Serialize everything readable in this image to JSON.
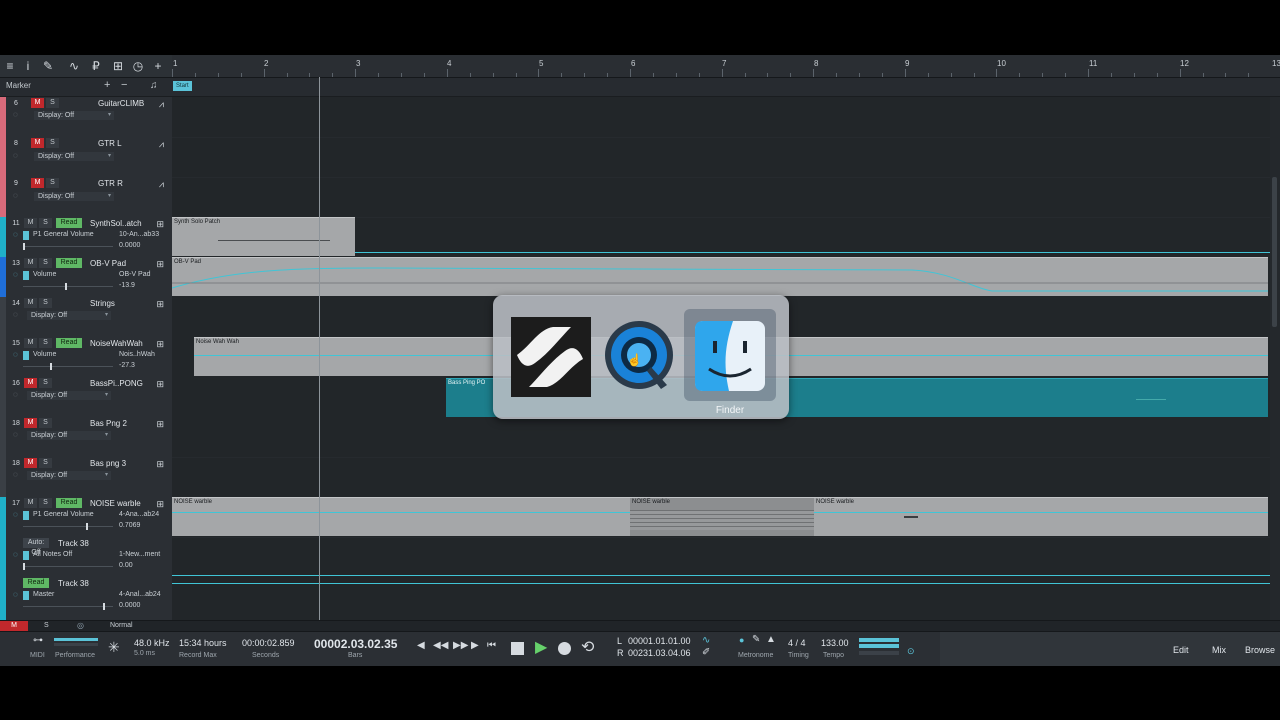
{
  "toolbar": {
    "icons": [
      "menu-icon",
      "info-icon",
      "wrench-icon",
      "curve-icon",
      "pen-icon",
      "grid-icon",
      "clock-icon",
      "add-icon"
    ]
  },
  "ruler": {
    "bars": [
      "1",
      "2",
      "3",
      "4",
      "5",
      "6",
      "7",
      "8",
      "9",
      "10",
      "11",
      "12",
      "13"
    ]
  },
  "marker": {
    "label": "Marker",
    "add": "+",
    "remove": "−",
    "start": "Start"
  },
  "tracks": [
    {
      "num": "6",
      "name": "GuitarCLIMB",
      "display": "Display: Off",
      "m": "M",
      "s": "S"
    },
    {
      "num": "8",
      "name": "GTR L",
      "display": "Display: Off",
      "m": "M",
      "s": "S"
    },
    {
      "num": "9",
      "name": "GTR R",
      "display": "Display: Off",
      "m": "M",
      "s": "S"
    },
    {
      "num": "11",
      "name": "SynthSol..atch",
      "read": "Read",
      "param": "P1 General Volume",
      "inst": "10-An...ab33",
      "value": "0.0000",
      "m": "M",
      "s": "S"
    },
    {
      "num": "13",
      "name": "OB-V Pad",
      "read": "Read",
      "param": "Volume",
      "inst": "OB-V Pad",
      "value": "-13.9",
      "m": "M",
      "s": "S"
    },
    {
      "num": "14",
      "name": "Strings",
      "display": "Display: Off",
      "m": "M",
      "s": "S"
    },
    {
      "num": "15",
      "name": "NoiseWahWah",
      "read": "Read",
      "param": "Volume",
      "inst": "Nois..hWah",
      "value": "-27.3",
      "m": "M",
      "s": "S"
    },
    {
      "num": "16",
      "name": "BassPi..PONG",
      "display": "Display: Off",
      "m": "M",
      "s": "S"
    },
    {
      "num": "18",
      "name": "Bas Png 2",
      "display": "Display: Off",
      "m": "M",
      "s": "S"
    },
    {
      "num": "18",
      "name": "Bas png 3",
      "display": "Display: Off",
      "m": "M",
      "s": "S"
    },
    {
      "num": "17",
      "name": "NOISE warble",
      "read": "Read",
      "param": "P1 General Volume",
      "inst": "4-Ana...ab24",
      "value": "0.7069",
      "m": "M",
      "s": "S"
    },
    {
      "auto": "Auto: Off",
      "name": "Track 38",
      "param": "All Notes Off",
      "inst": "1-New...ment",
      "value": "0.00"
    },
    {
      "read": "Read",
      "name": "Track 38",
      "param": "Master",
      "inst": "4-Anal...ab24",
      "value": "0.0000"
    }
  ],
  "clips": {
    "synth_solo": "Synth Solo Patch",
    "obv_pad": "OB-V Pad",
    "noise_wah": "Noise Wah Wah",
    "bass_ping": "Bass Ping PO",
    "noise_warble_1": "NOISE warble",
    "noise_warble_2": "NOISE warble",
    "noise_warble_3": "NOISE warble"
  },
  "status_strip": {
    "m": "M",
    "s": "S",
    "mode": "Normal"
  },
  "transport": {
    "midi": "MIDI",
    "performance": "Performance",
    "sample_rate": "48.0 kHz",
    "latency": "5.0 ms",
    "record_time": "15:34 hours",
    "record_max": "Record Max",
    "seconds_value": "00:00:02.859",
    "seconds_label": "Seconds",
    "bars_value": "00002.03.02.35",
    "bars_label": "Bars",
    "loop_l_label": "L",
    "loop_l": "00001.01.01.00",
    "loop_r_label": "R",
    "loop_r": "00231.03.04.06",
    "metronome": "Metronome",
    "timing_value": "4 / 4",
    "timing": "Timing",
    "tempo_value": "133.00",
    "tempo": "Tempo",
    "edit": "Edit",
    "mix": "Mix",
    "browse": "Browse"
  },
  "switcher": {
    "apps": [
      "studio-one-app-icon",
      "quicktime-app-icon",
      "finder-app-icon"
    ],
    "selected_label": "Finder"
  }
}
